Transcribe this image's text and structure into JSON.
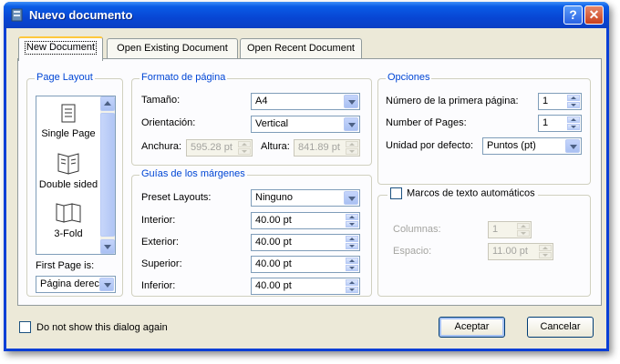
{
  "window": {
    "title": "Nuevo documento",
    "help_label": "?",
    "close_label": "✕"
  },
  "tabs": [
    {
      "label": "New Document",
      "active": true
    },
    {
      "label": "Open Existing Document",
      "active": false
    },
    {
      "label": "Open Recent Document",
      "active": false
    }
  ],
  "page_layout": {
    "legend": "Page Layout",
    "items": [
      {
        "label": "Single Page",
        "icon": "single-page-icon"
      },
      {
        "label": "Double sided",
        "icon": "double-sided-icon",
        "selected": true
      },
      {
        "label": "3-Fold",
        "icon": "three-fold-icon"
      }
    ],
    "first_page_label": "First Page is:",
    "first_page_value": "Página derec"
  },
  "formato": {
    "legend": "Formato de página",
    "size_label": "Tamaño:",
    "size_value": "A4",
    "orientation_label": "Orientación:",
    "orientation_value": "Vertical",
    "width_label": "Anchura:",
    "width_value": "595.28 pt",
    "height_label": "Altura:",
    "height_value": "841.89 pt"
  },
  "margenes": {
    "legend": "Guías de los márgenes",
    "preset_label": "Preset Layouts:",
    "preset_value": "Ninguno",
    "interior_label": "Interior:",
    "interior_value": "40.00 pt",
    "exterior_label": "Exterior:",
    "exterior_value": "40.00 pt",
    "superior_label": "Superior:",
    "superior_value": "40.00 pt",
    "inferior_label": "Inferior:",
    "inferior_value": "40.00 pt"
  },
  "opciones": {
    "legend": "Opciones",
    "first_page_number_label": "Número de la primera página:",
    "first_page_number_value": "1",
    "pages_label": "Number of Pages:",
    "pages_value": "1",
    "unit_label": "Unidad por defecto:",
    "unit_value": "Puntos (pt)"
  },
  "marcos": {
    "label": "Marcos de texto automáticos",
    "columns_label": "Columnas:",
    "columns_value": "1",
    "spacing_label": "Espacio:",
    "spacing_value": "11.00 pt"
  },
  "footer": {
    "dont_show_label": "Do not show this dialog again",
    "accept_label": "Aceptar",
    "cancel_label": "Cancelar"
  },
  "colors": {
    "title_bar": "#0846d4",
    "legend_text": "#0046d5",
    "dialog_bg": "#ece9d8"
  }
}
